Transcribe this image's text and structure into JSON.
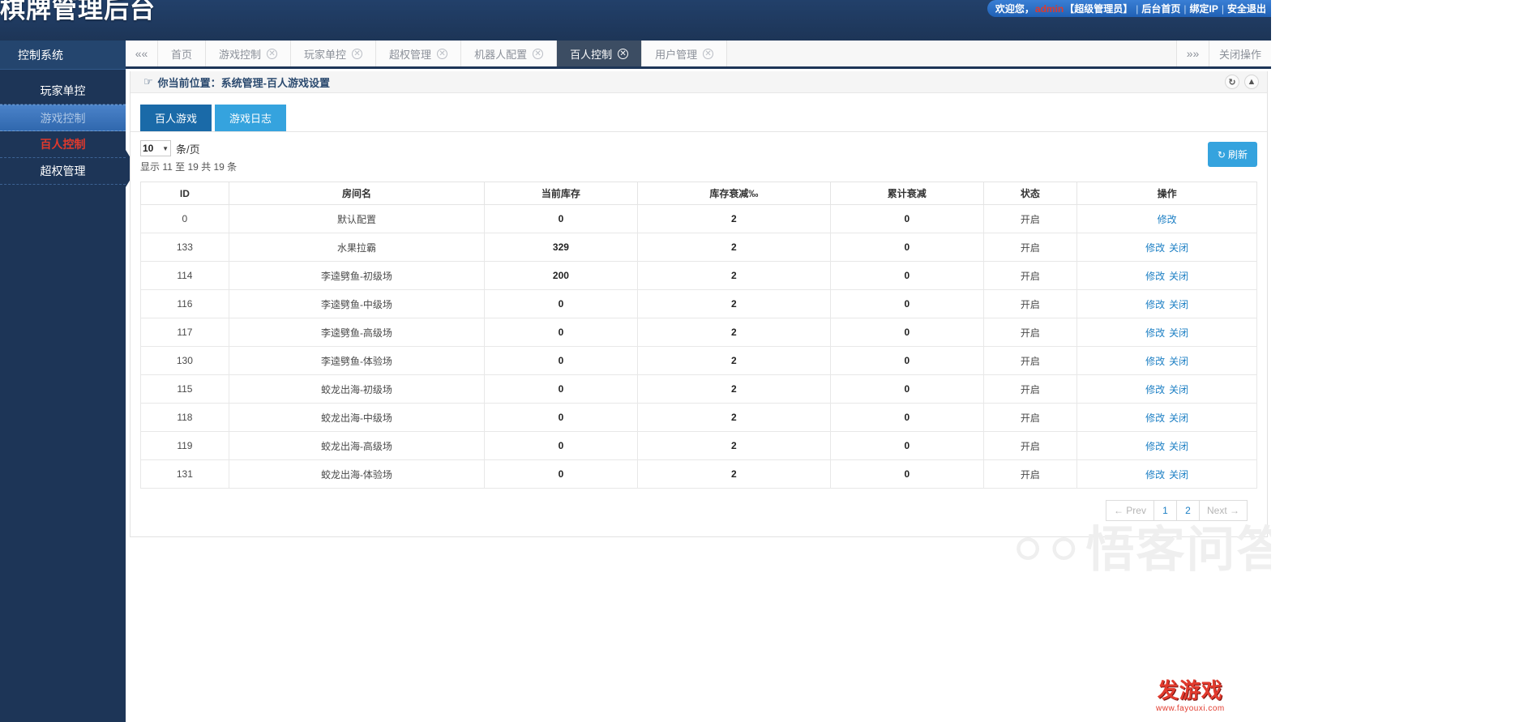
{
  "header": {
    "brand": "棋牌管理后台",
    "welcome_prefix": "欢迎您，",
    "username": "admin",
    "role": "【超级管理员】",
    "links": [
      "后台首页",
      "绑定IP",
      "安全退出"
    ]
  },
  "sidebar": {
    "title": "控制系统",
    "items": [
      {
        "label": "玩家单控",
        "state": "normal"
      },
      {
        "label": "游戏控制",
        "state": "active"
      },
      {
        "label": "百人控制",
        "state": "alert"
      },
      {
        "label": "超权管理",
        "state": "normal"
      }
    ]
  },
  "tabbar": {
    "prev_icon": "double-chevron-left-icon",
    "next_icon": "double-chevron-right-icon",
    "close_all_label": "关闭操作",
    "tabs": [
      {
        "label": "首页",
        "closable": false,
        "active": false
      },
      {
        "label": "游戏控制",
        "closable": true,
        "active": false
      },
      {
        "label": "玩家单控",
        "closable": true,
        "active": false
      },
      {
        "label": "超权管理",
        "closable": true,
        "active": false
      },
      {
        "label": "机器人配置",
        "closable": true,
        "active": false
      },
      {
        "label": "百人控制",
        "closable": true,
        "active": true
      },
      {
        "label": "用户管理",
        "closable": true,
        "active": false
      }
    ]
  },
  "breadcrumb": {
    "icon": "hand-pointer-icon",
    "text": "你当前位置：系统管理-百人游戏设置",
    "refresh_icon": "refresh-icon",
    "collapse_icon": "chevron-up-icon"
  },
  "subtabs": [
    {
      "label": "百人游戏",
      "style": "primary"
    },
    {
      "label": "游戏日志",
      "style": "info"
    }
  ],
  "toolbar": {
    "page_size_value": "10",
    "page_size_label": "条/页",
    "showing_text": "显示 11 至 19 共 19 条",
    "refresh_label": "刷新",
    "refresh_icon": "refresh-icon"
  },
  "table": {
    "columns": [
      "ID",
      "房间名",
      "当前库存",
      "库存衰减‰",
      "累计衰减",
      "状态",
      "操作"
    ],
    "rows": [
      {
        "id": "0",
        "room": "默认配置",
        "stock": "0",
        "decay": "2",
        "total": "0",
        "status": "开启",
        "actions": [
          "修改"
        ]
      },
      {
        "id": "133",
        "room": "水果拉霸",
        "stock": "329",
        "decay": "2",
        "total": "0",
        "status": "开启",
        "actions": [
          "修改",
          "关闭"
        ]
      },
      {
        "id": "114",
        "room": "李逵劈鱼-初级场",
        "stock": "200",
        "decay": "2",
        "total": "0",
        "status": "开启",
        "actions": [
          "修改",
          "关闭"
        ]
      },
      {
        "id": "116",
        "room": "李逵劈鱼-中级场",
        "stock": "0",
        "decay": "2",
        "total": "0",
        "status": "开启",
        "actions": [
          "修改",
          "关闭"
        ]
      },
      {
        "id": "117",
        "room": "李逵劈鱼-高级场",
        "stock": "0",
        "decay": "2",
        "total": "0",
        "status": "开启",
        "actions": [
          "修改",
          "关闭"
        ]
      },
      {
        "id": "130",
        "room": "李逵劈鱼-体验场",
        "stock": "0",
        "decay": "2",
        "total": "0",
        "status": "开启",
        "actions": [
          "修改",
          "关闭"
        ]
      },
      {
        "id": "115",
        "room": "蛟龙出海-初级场",
        "stock": "0",
        "decay": "2",
        "total": "0",
        "status": "开启",
        "actions": [
          "修改",
          "关闭"
        ]
      },
      {
        "id": "118",
        "room": "蛟龙出海-中级场",
        "stock": "0",
        "decay": "2",
        "total": "0",
        "status": "开启",
        "actions": [
          "修改",
          "关闭"
        ]
      },
      {
        "id": "119",
        "room": "蛟龙出海-高级场",
        "stock": "0",
        "decay": "2",
        "total": "0",
        "status": "开启",
        "actions": [
          "修改",
          "关闭"
        ]
      },
      {
        "id": "131",
        "room": "蛟龙出海-体验场",
        "stock": "0",
        "decay": "2",
        "total": "0",
        "status": "开启",
        "actions": [
          "修改",
          "关闭"
        ]
      }
    ]
  },
  "pager": {
    "prev_label": "← Prev",
    "pages": [
      "1",
      "2"
    ],
    "next_label": "Next →",
    "current": "2"
  },
  "watermarks": {
    "wuyou_text": "悟客问答",
    "fayouxi_title": "发游戏",
    "fayouxi_url": "www.fayouxi.com"
  },
  "colors": {
    "brand_dark": "#1d3557",
    "accent_blue": "#35a3de",
    "primary_blue": "#1a6aa8",
    "alert_red": "#e0392c",
    "link_blue": "#1c7fc4"
  }
}
